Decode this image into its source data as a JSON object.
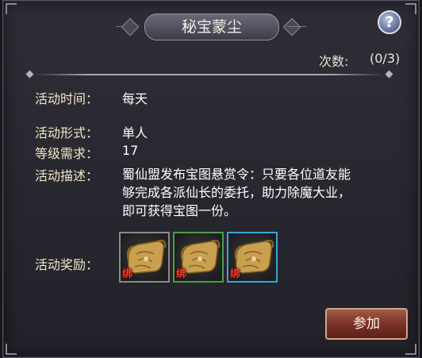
{
  "dialog": {
    "title": "秘宝蒙尘",
    "help_label": "?",
    "count_label": "次数:",
    "count_value": "(0/3)",
    "fields": {
      "time_label": "活动时间：",
      "time_value": "每天",
      "form_label": "活动形式：",
      "form_value": "单人",
      "level_label": "等级需求：",
      "level_value": "17",
      "desc_label": "活动描述：",
      "desc_lines": [
        "蜀仙盟发布宝图悬赏令：只要各位道友能",
        "够完成各派仙长的委托，助力除魔大业，",
        "即可获得宝图一份。"
      ],
      "reward_label": "活动奖励："
    },
    "rewards": [
      {
        "icon": "treasure-map-icon",
        "tag": "绑",
        "quality_color": "#8d8a86"
      },
      {
        "icon": "treasure-map-icon",
        "tag": "绑",
        "quality_color": "#4e9c47"
      },
      {
        "icon": "treasure-map-icon",
        "tag": "绑",
        "quality_color": "#3aa4d6"
      }
    ],
    "join_label": "参加"
  }
}
